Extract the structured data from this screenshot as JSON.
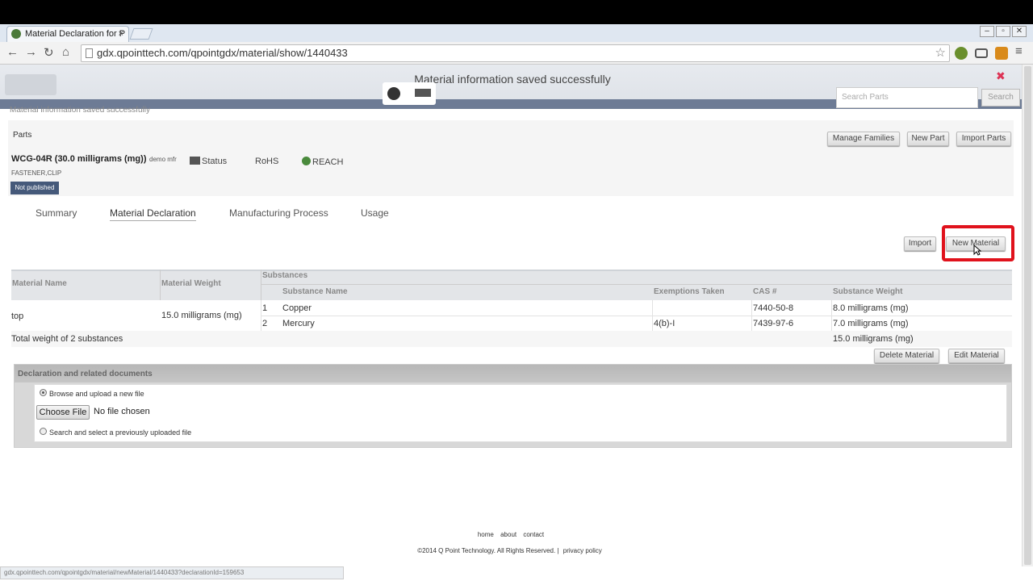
{
  "browser": {
    "tab_title": "Material Declaration for P",
    "tab_close": "×",
    "url": "gdx.qpointtech.com/qpointgdx/material/show/1440433",
    "status_url": "gdx.qpointtech.com/qpointgdx/material/newMaterial/1440433?declarationId=159653"
  },
  "header": {
    "flash_message": "Material information saved successfully",
    "flash_sub": "Material information saved successfully",
    "search_placeholder": "Search Parts",
    "search_label": "Search"
  },
  "parts": {
    "label": "Parts",
    "part_name": "WCG-04R (30.0 milligrams (mg))",
    "manufacturer": "demo mfr",
    "flags": [
      "Status",
      "RoHS",
      "REACH"
    ],
    "category": "FASTENER,CLIP",
    "publish_status": "Not published",
    "buttons": {
      "manage_families": "Manage Families",
      "new_part": "New Part",
      "import_parts": "Import Parts"
    }
  },
  "tabs": [
    "Summary",
    "Material Declaration",
    "Manufacturing Process",
    "Usage"
  ],
  "actions": {
    "import": "Import",
    "new_material": "New Material",
    "delete_material": "Delete Material",
    "edit_material": "Edit Material"
  },
  "table": {
    "headers": {
      "material_name": "Material Name",
      "material_weight": "Material Weight",
      "substances": "Substances",
      "substance_name": "Substance Name",
      "exemptions": "Exemptions Taken",
      "cas": "CAS #",
      "substance_weight": "Substance Weight"
    },
    "material": {
      "name": "top",
      "weight": "15.0 milligrams (mg)"
    },
    "rows": [
      {
        "index": "1",
        "name": "Copper",
        "exemption": "",
        "cas": "7440-50-8",
        "weight": "8.0 milligrams (mg)"
      },
      {
        "index": "2",
        "name": "Mercury",
        "exemption": "4(b)-I",
        "cas": "7439-97-6",
        "weight": "7.0 milligrams (mg)"
      }
    ],
    "total_label": "Total weight of 2 substances",
    "total_weight": "15.0 milligrams (mg)"
  },
  "declaration": {
    "title": "Declaration and related documents",
    "option_upload": "Browse and upload a new file",
    "choose_file": "Choose File",
    "no_file": "No file chosen",
    "option_search": "Search and select a previously uploaded file"
  },
  "footer": {
    "links": [
      "home",
      "about",
      "contact"
    ],
    "copyright": "©2014 Q Point Technology. All Rights Reserved.",
    "privacy": "privacy policy"
  },
  "colors": {
    "highlight": "#e0121c",
    "badge": "#45597a",
    "header_strip": "#6d7b95"
  }
}
